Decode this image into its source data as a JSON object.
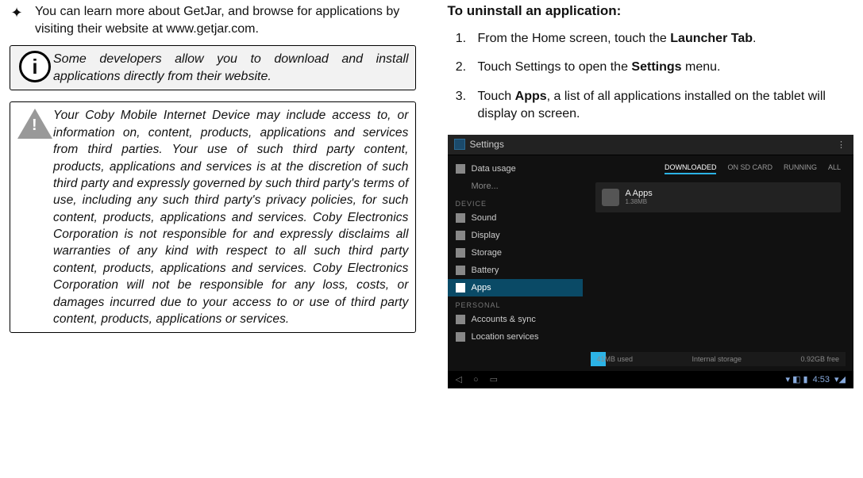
{
  "left": {
    "bullet": "You can learn more about GetJar, and browse for applications by visiting their website at www.getjar.com.",
    "info_note": "Some developers allow you to download and install applications directly from their website.",
    "warn_note": "Your Coby Mobile Internet Device may include access to, or information on, content, products, applications and services from third parties. Your use of such third party content, products, applications and services is at the discretion of such third party and expressly governed by such third party's terms of use, including any such third party's privacy policies, for such content, products, applications and services. Coby Electronics Corporation is not responsible for and expressly disclaims all warranties of any kind with respect to all such third party content, products, applications and services. Coby Electronics Corporation will not be responsible for any loss, costs, or damages incurred due to your access to or use of third party content, products, applications or services."
  },
  "right": {
    "heading": "To uninstall an application:",
    "step1_a": "From the Home screen, touch the ",
    "step1_b": "Launcher Tab",
    "step1_c": ".",
    "step2_a": "Touch Settings to open the ",
    "step2_b": "Settings",
    "step2_c": " menu.",
    "step3_a": "Touch ",
    "step3_b": "Apps",
    "step3_c": ", a list of all applications installed on the tablet will display on screen."
  },
  "shot": {
    "title": "Settings",
    "tabs": [
      "DOWNLOADED",
      "ON SD CARD",
      "RUNNING",
      "ALL"
    ],
    "side_items": [
      "Data usage",
      "More...",
      "Sound",
      "Display",
      "Storage",
      "Battery",
      "Apps",
      "Accounts & sync",
      "Location services"
    ],
    "side_head_device": "DEVICE",
    "side_head_personal": "PERSONAL",
    "app_name": "A Apps",
    "app_size": "1.38MB",
    "storage_label": "Internal storage",
    "storage_used": "41MB used",
    "storage_free": "0.92GB free",
    "clock": "4:53"
  }
}
